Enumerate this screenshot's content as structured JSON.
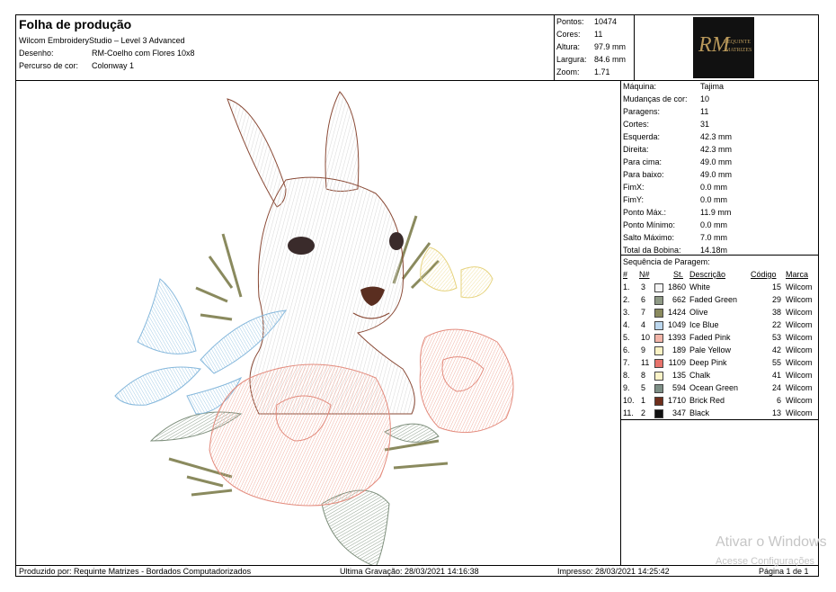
{
  "header": {
    "title": "Folha de produção",
    "software": "Wilcom EmbroideryStudio – Level 3 Advanced",
    "design_label": "Desenho:",
    "design_value": "RM-Coelho com Flores 10x8",
    "colorway_label": "Percurso de cor:",
    "colorway_value": "Colonway 1"
  },
  "stats": [
    {
      "label": "Pontos:",
      "value": "10474"
    },
    {
      "label": "Cores:",
      "value": "11"
    },
    {
      "label": "Altura:",
      "value": "97.9 mm"
    },
    {
      "label": "Largura:",
      "value": "84.6 mm"
    },
    {
      "label": "Zoom:",
      "value": "1.71"
    }
  ],
  "logo": {
    "mark": "RM",
    "line1": "REQUINTE",
    "line2": "MATRIZES"
  },
  "machine_info": [
    {
      "label": "Máquina:",
      "value": "Tajima"
    },
    {
      "label": "Mudanças de cor:",
      "value": "10"
    },
    {
      "label": "Paragens:",
      "value": "11"
    },
    {
      "label": "Cortes:",
      "value": "31"
    },
    {
      "label": "Esquerda:",
      "value": "42.3 mm"
    },
    {
      "label": "Direita:",
      "value": "42.3 mm"
    },
    {
      "label": "Para cima:",
      "value": "49.0 mm"
    },
    {
      "label": "Para baixo:",
      "value": "49.0 mm"
    },
    {
      "label": "FimX:",
      "value": "0.0 mm"
    },
    {
      "label": "FimY:",
      "value": "0.0 mm"
    },
    {
      "label": "Ponto Máx.:",
      "value": "11.9 mm"
    },
    {
      "label": "Ponto Mínimo:",
      "value": "0.0 mm"
    },
    {
      "label": "Salto Máximo:",
      "value": "7.0 mm"
    },
    {
      "label": "Total da Bobina:",
      "value": "14.18m"
    }
  ],
  "sequence": {
    "title": "Sequência de Paragem:",
    "headers": {
      "num": "#",
      "n": "N#",
      "st": "St.",
      "desc": "Descrição",
      "code": "Código",
      "brand": "Marca"
    },
    "rows": [
      {
        "num": "1.",
        "n": "3",
        "st": "1860",
        "desc": "White",
        "code": "15",
        "brand": "Wilcom",
        "color": "#f4f4f4"
      },
      {
        "num": "2.",
        "n": "6",
        "st": "662",
        "desc": "Faded Green",
        "code": "29",
        "brand": "Wilcom",
        "color": "#8f9a86"
      },
      {
        "num": "3.",
        "n": "7",
        "st": "1424",
        "desc": "Olive",
        "code": "38",
        "brand": "Wilcom",
        "color": "#8a8a5e"
      },
      {
        "num": "4.",
        "n": "4",
        "st": "1049",
        "desc": "Ice Blue",
        "code": "22",
        "brand": "Wilcom",
        "color": "#bcd7ee"
      },
      {
        "num": "5.",
        "n": "10",
        "st": "1393",
        "desc": "Faded Pink",
        "code": "53",
        "brand": "Wilcom",
        "color": "#f3b5a8"
      },
      {
        "num": "6.",
        "n": "9",
        "st": "189",
        "desc": "Pale Yellow",
        "code": "42",
        "brand": "Wilcom",
        "color": "#fbf2c4"
      },
      {
        "num": "7.",
        "n": "11",
        "st": "1109",
        "desc": "Deep Pink",
        "code": "55",
        "brand": "Wilcom",
        "color": "#e8736c"
      },
      {
        "num": "8.",
        "n": "8",
        "st": "135",
        "desc": "Chalk",
        "code": "41",
        "brand": "Wilcom",
        "color": "#fbf3c8"
      },
      {
        "num": "9.",
        "n": "5",
        "st": "594",
        "desc": "Ocean Green",
        "code": "24",
        "brand": "Wilcom",
        "color": "#7d8f86"
      },
      {
        "num": "10.",
        "n": "1",
        "st": "1710",
        "desc": "Brick Red",
        "code": "6",
        "brand": "Wilcom",
        "color": "#6e2e1c"
      },
      {
        "num": "11.",
        "n": "2",
        "st": "347",
        "desc": "Black",
        "code": "13",
        "brand": "Wilcom",
        "color": "#111111"
      }
    ]
  },
  "footer": {
    "produced_by": "Produzido por: Requinte Matrizes - Bordados Computadorizados",
    "last_saved": "Ultima Gravação: 28/03/2021 14:16:38",
    "printed": "Impresso: 28/03/2021 14:25:42",
    "page": "Página 1 de 1"
  },
  "watermark": {
    "line1": "Ativar o Windows",
    "line2": "Acesse Configurações"
  }
}
